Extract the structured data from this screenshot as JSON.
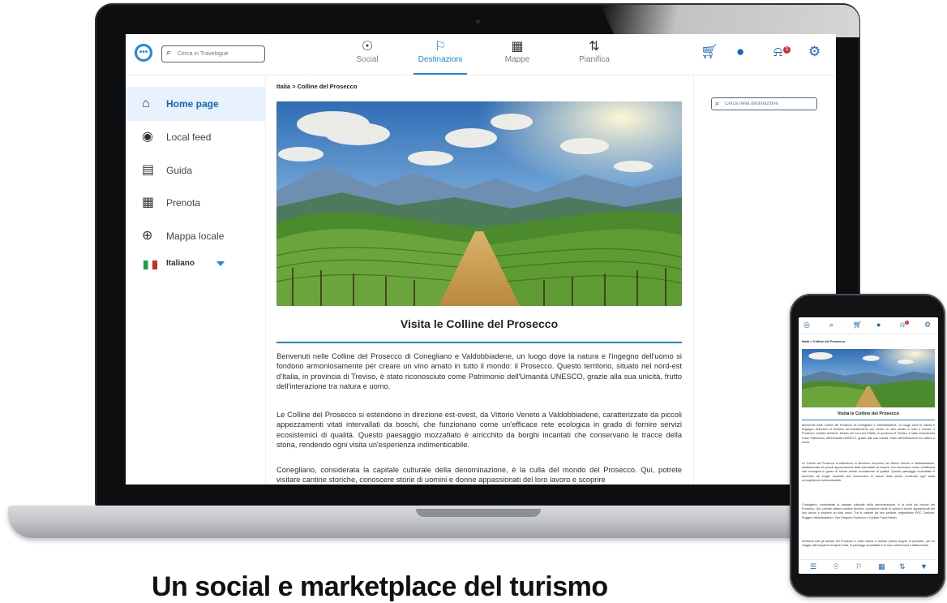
{
  "topbar": {
    "search_placeholder": "Cerca in Travelogue",
    "nav": [
      {
        "label": "Social",
        "icon": "pin-icon"
      },
      {
        "label": "Destinazioni",
        "icon": "flag-icon"
      },
      {
        "label": "Mappe",
        "icon": "map-icon"
      },
      {
        "label": "Pianifica",
        "icon": "route-icon"
      }
    ],
    "notification_count": "1"
  },
  "sidebar": {
    "items": [
      {
        "label": "Home page",
        "icon": "home-icon"
      },
      {
        "label": "Local feed",
        "icon": "location-icon"
      },
      {
        "label": "Guida",
        "icon": "book-icon"
      },
      {
        "label": "Prenota",
        "icon": "calendar-icon"
      },
      {
        "label": "Mappa locale",
        "icon": "compass-icon"
      }
    ],
    "language": "Italiano"
  },
  "main": {
    "breadcrumb": "Italia > Colline del Prosecco",
    "title": "Visita le Colline del Prosecco",
    "paragraphs": [
      "Benvenuti nelle Colline del Prosecco di Conegliano e Valdobbiadene, un luogo dove la natura e l'ingegno dell'uomo si fondono armoniosamente per creare un vino amato in tutto il mondo: il Prosecco. Questo territorio, situato nel nord-est d'Italia, in provincia di Treviso, è stato riconosciuto come Patrimonio dell'Umanità UNESCO, grazie alla sua unicità, frutto dell'interazione tra natura e uomo.",
      "Le Colline del Prosecco si estendono in direzione est-ovest, da Vittorio Veneto a Valdobbiadene, caratterizzate da piccoli appezzamenti vitati intervallati da boschi, che funzionano come un'efficace rete ecologica in grado di fornire servizi ecosistemici di qualità. Questo paesaggio mozzafiato è arricchito da borghi incantati che conservano le tracce della storia, rendendo ogni visita un'esperienza indimenticabile.",
      "Conegliano, considerata la capitale culturale della denominazione, è la culla del mondo del Prosecco. Qui, potrete visitare cantine storiche, conoscere storie di uomini e donne appassionati del loro lavoro e scoprire"
    ],
    "right_search_placeholder": "Cerca nella destinazione"
  },
  "phone": {
    "breadcrumb": "Italia > Colline del Prosecco",
    "title": "Visita le Colline del Prosecco",
    "paragraphs": [
      "Benvenuti nelle Colline del Prosecco di Conegliano e Valdobbiadene, un luogo dove la natura e l'ingegno dell'uomo si fondono armoniosamente per creare un vino amato in tutto il mondo: il Prosecco. Questo territorio, situato nel nord-est d'Italia, in provincia di Treviso, è stato riconosciuto come Patrimonio dell'Umanità UNESCO, grazie alla sua unicità, frutto dell'interazione tra natura e uomo.",
      "Le Colline del Prosecco si estendono in direzione est-ovest, da Vittorio Veneto a Valdobbiadene, caratterizzate da piccoli appezzamenti vitati intervallati da boschi, che funzionano come un'efficace rete ecologica in grado di fornire servizi ecosistemici di qualità. Questo paesaggio mozzafiato è arricchito da borghi incantati che conservano le tracce della storia, rendendo ogni visita un'esperienza indimenticabile.",
      "Conegliano, considerata la capitale culturale della denominazione, è la culla del mondo del Prosecco. Qui, potrete visitare cantine storiche, conoscere storie di uomini e donne appassionati del loro lavoro e scoprire un vino unico. Tra le cantine da non perdere, segnaliamo PDC Cartizze, Ruggeri Valdobbiadene, San Gregorio Prosecco e Cantine Fasol Menin.",
      "Invitiamo tutti gli amanti del Prosecco e della natura a visitare questo angolo di paradiso, per un viaggio alla scoperta di sapori unici, di paesaggi mozzafiato e di una cultura ricca e affascinante."
    ],
    "notification_count": "1"
  },
  "caption": "Un social e marketplace del turismo",
  "colors": {
    "accent": "#1e88e5",
    "accent_dark": "#1565c0",
    "badge": "#d32f2f"
  }
}
